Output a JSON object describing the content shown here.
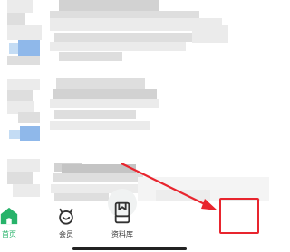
{
  "tabs": [
    {
      "label": "首页",
      "icon": "home-icon",
      "active": true
    },
    {
      "label": "会员",
      "icon": "member-icon",
      "active": false
    },
    {
      "label": "资料库",
      "icon": "library-icon",
      "active": false
    }
  ],
  "colors": {
    "active_tab": "#27b36a",
    "inactive_tab": "#333333",
    "annotation": "#e8252e"
  }
}
